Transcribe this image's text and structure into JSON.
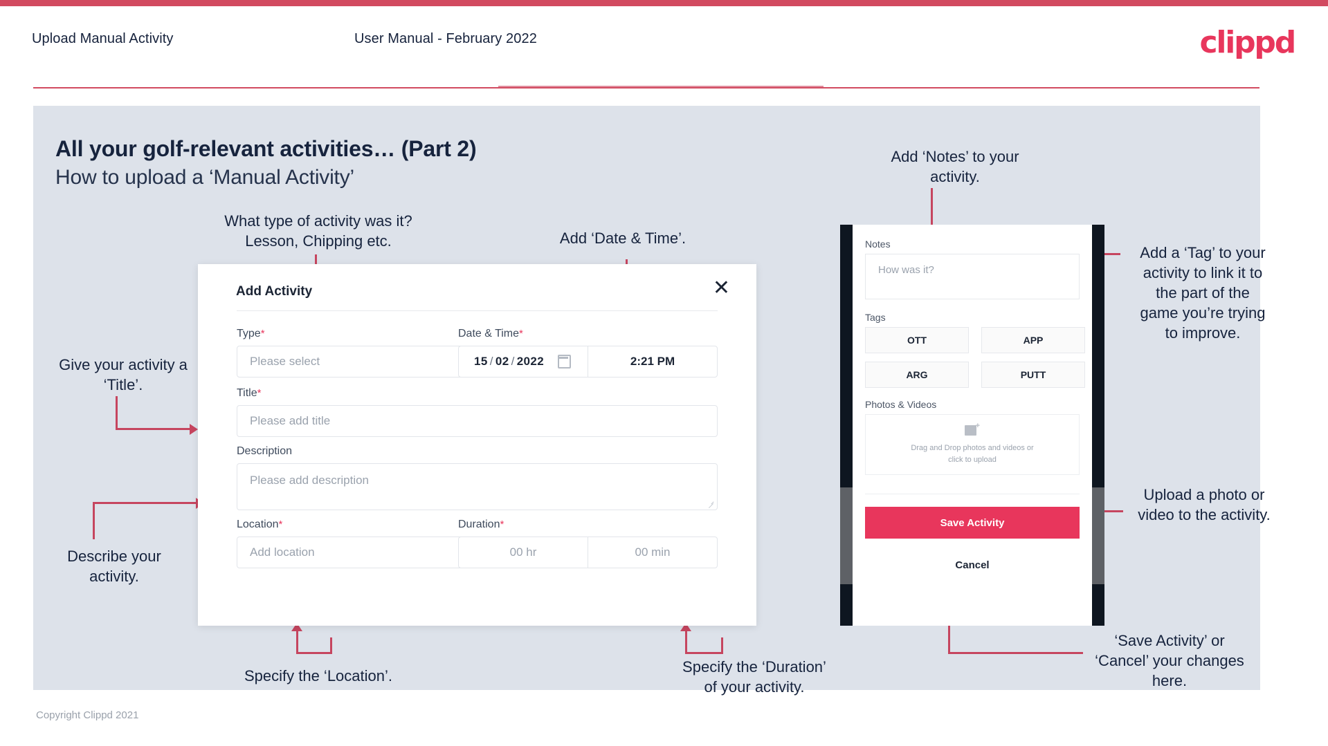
{
  "header": {
    "left_title": "Upload Manual Activity",
    "center_title": "User Manual - February 2022",
    "logo": "clippd"
  },
  "slide": {
    "title": "All your golf-relevant activities… (Part 2)",
    "subtitle": "How to upload a ‘Manual Activity’",
    "footer": "Copyright Clippd 2021"
  },
  "annotations": {
    "type": "What type of activity was it?\nLesson, Chipping etc.",
    "datetime": "Add ‘Date & Time’.",
    "title": "Give your activity a\n‘Title’.",
    "description": "Describe your\nactivity.",
    "location": "Specify the ‘Location’.",
    "duration": "Specify the ‘Duration’\nof your activity.",
    "notes": "Add ‘Notes’ to your\nactivity.",
    "tags": "Add a ‘Tag’ to your\nactivity to link it to\nthe part of the\ngame you’re trying\nto improve.",
    "upload": "Upload a photo or\nvideo to the activity.",
    "save": "‘Save Activity’ or\n‘Cancel’ your changes\nhere."
  },
  "dialog": {
    "title": "Add Activity",
    "close_icon": "close-icon",
    "fields": {
      "type_label": "Type",
      "type_placeholder": "Please select",
      "datetime_label": "Date & Time",
      "date_day": "15",
      "date_month": "02",
      "date_year": "2022",
      "time_value": "2:21 PM",
      "title_label": "Title",
      "title_placeholder": "Please add title",
      "description_label": "Description",
      "description_placeholder": "Please add description",
      "location_label": "Location",
      "location_placeholder": "Add location",
      "duration_label": "Duration",
      "duration_hours": "00 hr",
      "duration_minutes": "00 min",
      "required_marker": "*"
    }
  },
  "phone": {
    "notes_label": "Notes",
    "notes_placeholder": "How was it?",
    "tags_label": "Tags",
    "tags": [
      "OTT",
      "APP",
      "ARG",
      "PUTT"
    ],
    "photos_label": "Photos & Videos",
    "upload_text": "Drag and Drop photos and videos or\nclick to upload",
    "save_label": "Save Activity",
    "cancel_label": "Cancel"
  },
  "colors": {
    "accent": "#e8365c",
    "arrow": "#c6455f",
    "slide_bg": "#dde2ea",
    "text": "#16233d"
  }
}
